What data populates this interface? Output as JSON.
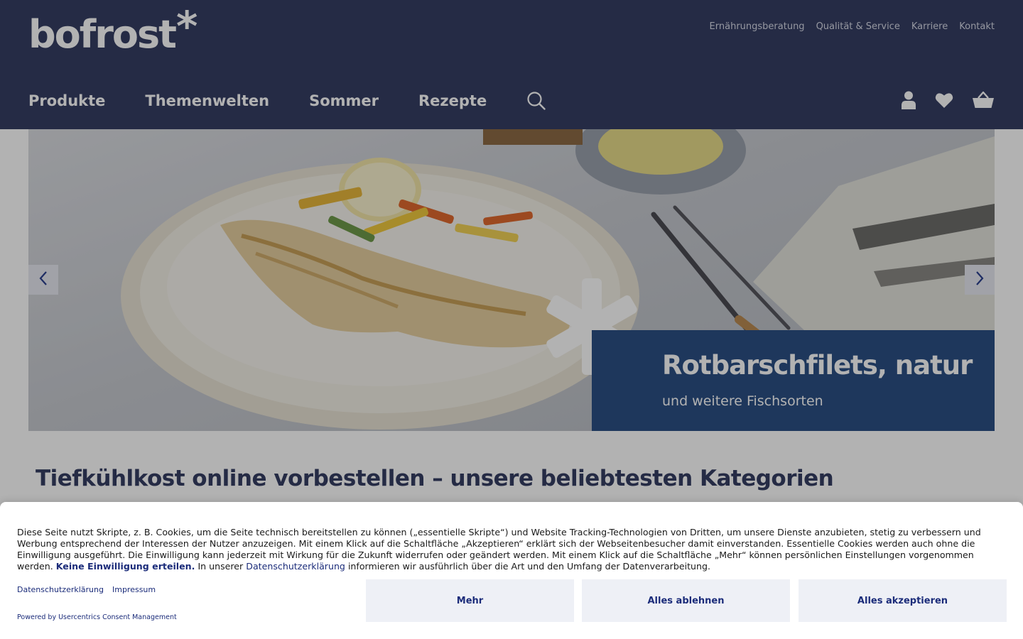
{
  "header": {
    "logo_text": "bofrost",
    "logo_star": "*",
    "service_nav": [
      "Ernährungsberatung",
      "Qualität & Service",
      "Karriere",
      "Kontakt"
    ],
    "main_nav": [
      "Produkte",
      "Themenwelten",
      "Sommer",
      "Rezepte"
    ],
    "icons": [
      "search-icon",
      "account-icon",
      "heart-icon",
      "basket-icon"
    ]
  },
  "hero": {
    "title": "Rotbarschfilets, natur",
    "subtitle": "und weitere Fischsorten",
    "prev_icon": "chevron-left-icon",
    "next_icon": "chevron-right-icon"
  },
  "section": {
    "heading": "Tiefkühlkost online vorbestellen – unsere beliebtesten Kategorien"
  },
  "consent": {
    "text_1": "Diese Seite nutzt Skripte, z. B. Cookies, um die Seite technisch bereitstellen zu können („essentielle Skripte“) und Website Tracking-Technologien von Dritten, um unsere Dienste anzubieten, stetig zu verbessern und Werbung entsprechend der Interessen der Nutzer anzuzeigen. Mit einem Klick auf die Schaltfläche „Akzeptieren“ erklärt sich der Webseitenbesucher damit einverstanden. Essentielle Cookies werden auch ohne die Einwilligung ausgeführt. Die Einwilligung kann jederzeit mit Wirkung für die Zukunft widerrufen oder geändert werden. Mit einem Klick auf die Schaltfläche „Mehr“ können persönlichen Einstellungen vorgenommen werden.",
    "link_no_consent": "Keine Einwilligung erteilen.",
    "text_2": "In unserer",
    "link_privacy": "Datenschutzerklärung",
    "text_3": "informieren wir ausführlich über die Art und den Umfang der Datenverarbeitung.",
    "footer_links": [
      "Datenschutzerklärung",
      "Impressum"
    ],
    "powered_by": "Powered by Usercentrics Consent Management",
    "buttons": {
      "more": "Mehr",
      "reject": "Alles ablehnen",
      "accept": "Alles akzeptieren"
    }
  },
  "colors": {
    "header_bg": "#353e63",
    "caption_bg": "#2b4f85",
    "consent_link": "#1b2c7a",
    "button_bg": "#eef0f6"
  }
}
